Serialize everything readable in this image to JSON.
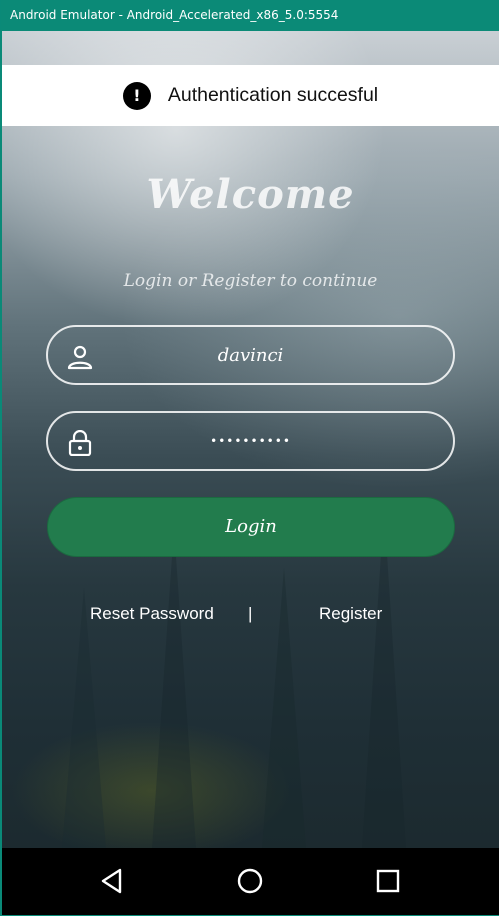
{
  "window": {
    "title": "Android Emulator - Android_Accelerated_x86_5.0:5554"
  },
  "toast": {
    "icon": "exclamation-icon",
    "message": "Authentication succesful"
  },
  "header": {
    "title": "Welcome",
    "subtitle": "Login or Register to continue"
  },
  "form": {
    "username": {
      "icon": "person-icon",
      "value": "davinci"
    },
    "password": {
      "icon": "lock-icon",
      "value": "••••••••••"
    },
    "login_label": "Login"
  },
  "links": {
    "reset_label": "Reset Password",
    "separator": "|",
    "register_label": "Register"
  },
  "navigation": {
    "back_icon": "back-triangle-icon",
    "home_icon": "home-circle-icon",
    "recents_icon": "recents-square-icon"
  },
  "colors": {
    "titlebar": "#0b8a77",
    "login_button": "#227c4d",
    "navbar": "#000000",
    "toast_bg": "#ffffff"
  }
}
